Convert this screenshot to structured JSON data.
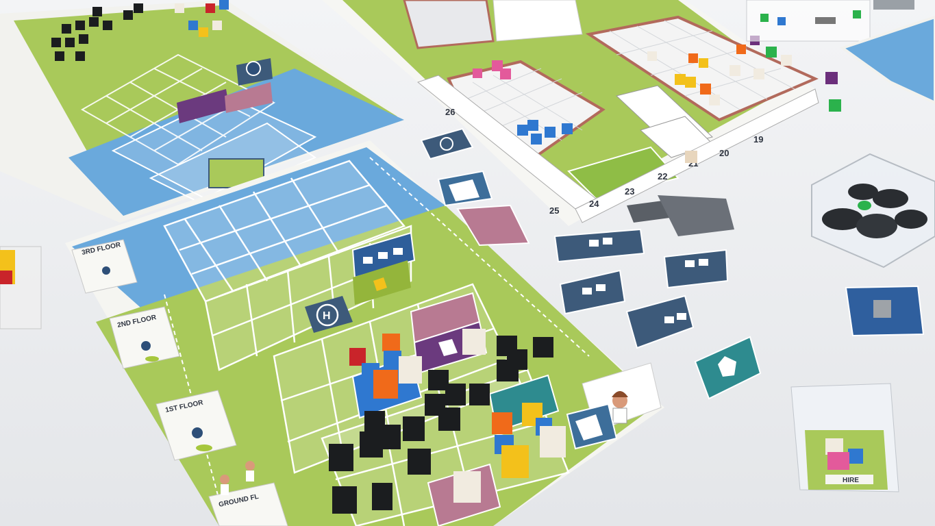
{
  "main_board": {
    "floors": [
      "3RD FLOOR",
      "2ND FLOOR",
      "1ST FLOOR",
      "GROUND FL"
    ],
    "helipad_letter": "H"
  },
  "city_board": {
    "track_numbers": [
      "26",
      "25",
      "24",
      "23",
      "22",
      "21",
      "20",
      "19"
    ]
  },
  "hire_card": {
    "label": "HIRE"
  },
  "colors": {
    "table": "#eceef0",
    "water": "#6aa9dc",
    "grass": "#a9c95a",
    "board_dark": "#3d5a7a",
    "cube_black": "#1b1d1f",
    "cube_orange": "#f06a1a",
    "cube_blue": "#2f78d0",
    "cube_yellow": "#f3c11b",
    "cube_pink": "#e35a9b",
    "cube_green": "#2bb24c",
    "cube_purple": "#6b2f7b",
    "cube_red": "#c9242a",
    "cube_white": "#f1ebe0"
  }
}
